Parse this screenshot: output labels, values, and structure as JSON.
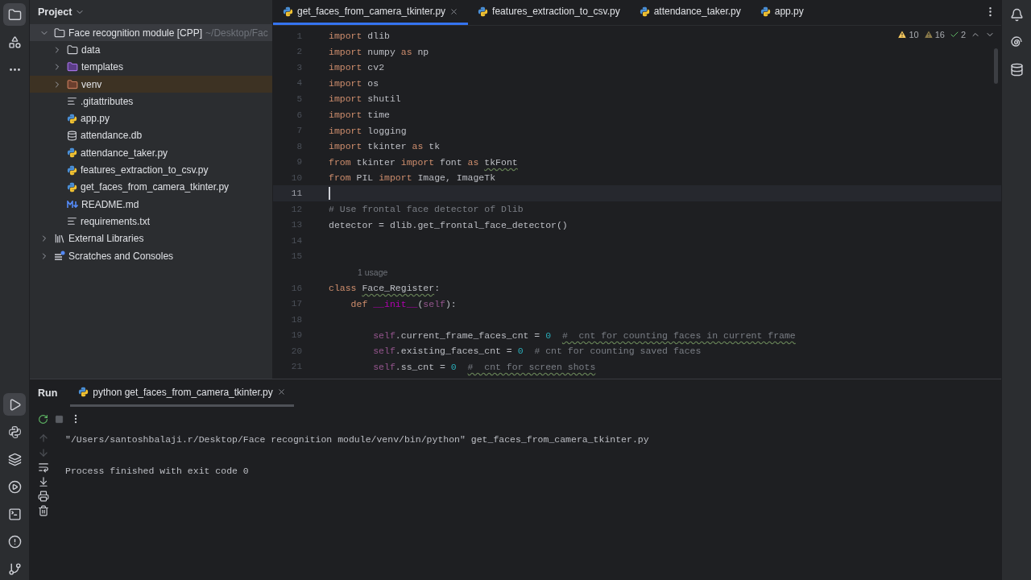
{
  "project_panel": {
    "title": "Project",
    "tree": [
      {
        "label": "Face recognition module [CPP]",
        "path": "~/Desktop/Fac",
        "kind": "folder",
        "expanded": true,
        "selected": false,
        "children": [
          {
            "label": "data",
            "kind": "folder",
            "expanded": false,
            "selected": false
          },
          {
            "label": "templates",
            "kind": "template-folder",
            "expanded": false,
            "selected": false
          },
          {
            "label": "venv",
            "kind": "excluded-folder",
            "expanded": false,
            "selected": true
          },
          {
            "label": ".gitattributes",
            "kind": "text",
            "selected": false
          },
          {
            "label": "app.py",
            "kind": "python",
            "selected": false
          },
          {
            "label": "attendance.db",
            "kind": "database",
            "selected": false
          },
          {
            "label": "attendance_taker.py",
            "kind": "python",
            "selected": false
          },
          {
            "label": "features_extraction_to_csv.py",
            "kind": "python",
            "selected": false
          },
          {
            "label": "get_faces_from_camera_tkinter.py",
            "kind": "python",
            "selected": false
          },
          {
            "label": "README.md",
            "kind": "markdown",
            "selected": false
          },
          {
            "label": "requirements.txt",
            "kind": "text",
            "selected": false
          }
        ]
      },
      {
        "label": "External Libraries",
        "kind": "library",
        "expanded": false,
        "selected": false
      },
      {
        "label": "Scratches and Consoles",
        "kind": "scratches",
        "expanded": false,
        "selected": false
      }
    ]
  },
  "editor_tabs": [
    {
      "label": "get_faces_from_camera_tkinter.py",
      "selected": true
    },
    {
      "label": "features_extraction_to_csv.py",
      "selected": false
    },
    {
      "label": "attendance_taker.py",
      "selected": false
    },
    {
      "label": "app.py",
      "selected": false
    }
  ],
  "inspections": {
    "warnings": "10",
    "weak_warnings": "16",
    "typos": "2"
  },
  "code_lines": [
    {
      "number": "1",
      "current": false,
      "tokens": [
        {
          "kind": "kw",
          "text": "import"
        },
        {
          "kind": "plain",
          "text": " dlib"
        }
      ]
    },
    {
      "number": "2",
      "current": false,
      "tokens": [
        {
          "kind": "kw",
          "text": "import"
        },
        {
          "kind": "plain",
          "text": " numpy "
        },
        {
          "kind": "kw",
          "text": "as"
        },
        {
          "kind": "plain",
          "text": " np"
        }
      ]
    },
    {
      "number": "3",
      "current": false,
      "tokens": [
        {
          "kind": "kw",
          "text": "import"
        },
        {
          "kind": "plain",
          "text": " cv2"
        }
      ]
    },
    {
      "number": "4",
      "current": false,
      "tokens": [
        {
          "kind": "kw",
          "text": "import"
        },
        {
          "kind": "plain",
          "text": " os"
        }
      ]
    },
    {
      "number": "5",
      "current": false,
      "tokens": [
        {
          "kind": "kw",
          "text": "import"
        },
        {
          "kind": "plain",
          "text": " shutil"
        }
      ]
    },
    {
      "number": "6",
      "current": false,
      "tokens": [
        {
          "kind": "kw",
          "text": "import"
        },
        {
          "kind": "plain",
          "text": " time"
        }
      ]
    },
    {
      "number": "7",
      "current": false,
      "tokens": [
        {
          "kind": "kw",
          "text": "import"
        },
        {
          "kind": "plain",
          "text": " logging"
        }
      ]
    },
    {
      "number": "8",
      "current": false,
      "tokens": [
        {
          "kind": "kw",
          "text": "import"
        },
        {
          "kind": "plain",
          "text": " tkinter "
        },
        {
          "kind": "kw",
          "text": "as"
        },
        {
          "kind": "plain",
          "text": " tk"
        }
      ]
    },
    {
      "number": "9",
      "current": false,
      "tokens": [
        {
          "kind": "kw",
          "text": "from"
        },
        {
          "kind": "plain",
          "text": " tkinter "
        },
        {
          "kind": "kw",
          "text": "import"
        },
        {
          "kind": "plain",
          "text": " font "
        },
        {
          "kind": "kw",
          "text": "as "
        },
        {
          "kind": "typo",
          "text": "tkFont"
        }
      ]
    },
    {
      "number": "10",
      "current": false,
      "tokens": [
        {
          "kind": "kw",
          "text": "from"
        },
        {
          "kind": "plain",
          "text": " PIL "
        },
        {
          "kind": "kw",
          "text": "import"
        },
        {
          "kind": "plain",
          "text": " Image, ImageTk"
        }
      ]
    },
    {
      "number": "11",
      "current": true
    },
    {
      "number": "12",
      "current": false,
      "tokens": [
        {
          "kind": "comment",
          "text": "# Use frontal face detector of Dlib"
        }
      ]
    },
    {
      "number": "13",
      "current": false,
      "tokens": [
        {
          "kind": "plain",
          "text": "detector = dlib.get_frontal_face_detector()"
        }
      ]
    },
    {
      "number": "14",
      "current": false
    },
    {
      "number": "15",
      "current": false
    },
    {
      "kind": "hint",
      "text": "1 usage"
    },
    {
      "number": "16",
      "current": false,
      "tokens": [
        {
          "kind": "kw",
          "text": "class "
        },
        {
          "kind": "typo",
          "text": "Face_Register"
        },
        {
          "kind": "plain",
          "text": ":"
        }
      ]
    },
    {
      "number": "17",
      "current": false,
      "tokens": [
        {
          "kind": "kw",
          "text": "    def "
        },
        {
          "kind": "dunder",
          "text": "__init__"
        },
        {
          "kind": "plain",
          "text": "("
        },
        {
          "kind": "self",
          "text": "self"
        },
        {
          "kind": "plain",
          "text": "):"
        }
      ]
    },
    {
      "number": "18",
      "current": false
    },
    {
      "number": "19",
      "current": false,
      "tokens": [
        {
          "kind": "self",
          "text": "        self"
        },
        {
          "kind": "plain",
          "text": ".current_frame_faces_cnt = "
        },
        {
          "kind": "num",
          "text": "0  "
        },
        {
          "kind": "typo-comment",
          "text": "#  cnt for counting faces in current frame"
        }
      ]
    },
    {
      "number": "20",
      "current": false,
      "tokens": [
        {
          "kind": "self",
          "text": "        self"
        },
        {
          "kind": "plain",
          "text": ".existing_faces_cnt = "
        },
        {
          "kind": "num",
          "text": "0  "
        },
        {
          "kind": "comment",
          "text": "# cnt for counting saved faces"
        }
      ]
    },
    {
      "number": "21",
      "current": false,
      "tokens": [
        {
          "kind": "self",
          "text": "        self"
        },
        {
          "kind": "plain",
          "text": ".ss_cnt = "
        },
        {
          "kind": "num",
          "text": "0  "
        },
        {
          "kind": "typo-comment",
          "text": "#  cnt for screen shots"
        }
      ]
    }
  ],
  "run_panel": {
    "title": "Run",
    "tabs": [
      {
        "label": "python get_faces_from_camera_tkinter.py",
        "selected": true
      }
    ],
    "console": [
      "\"/Users/santoshbalaji.r/Desktop/Face recognition module/venv/bin/python\" get_faces_from_camera_tkinter.py",
      "Process finished with exit code 0"
    ]
  }
}
